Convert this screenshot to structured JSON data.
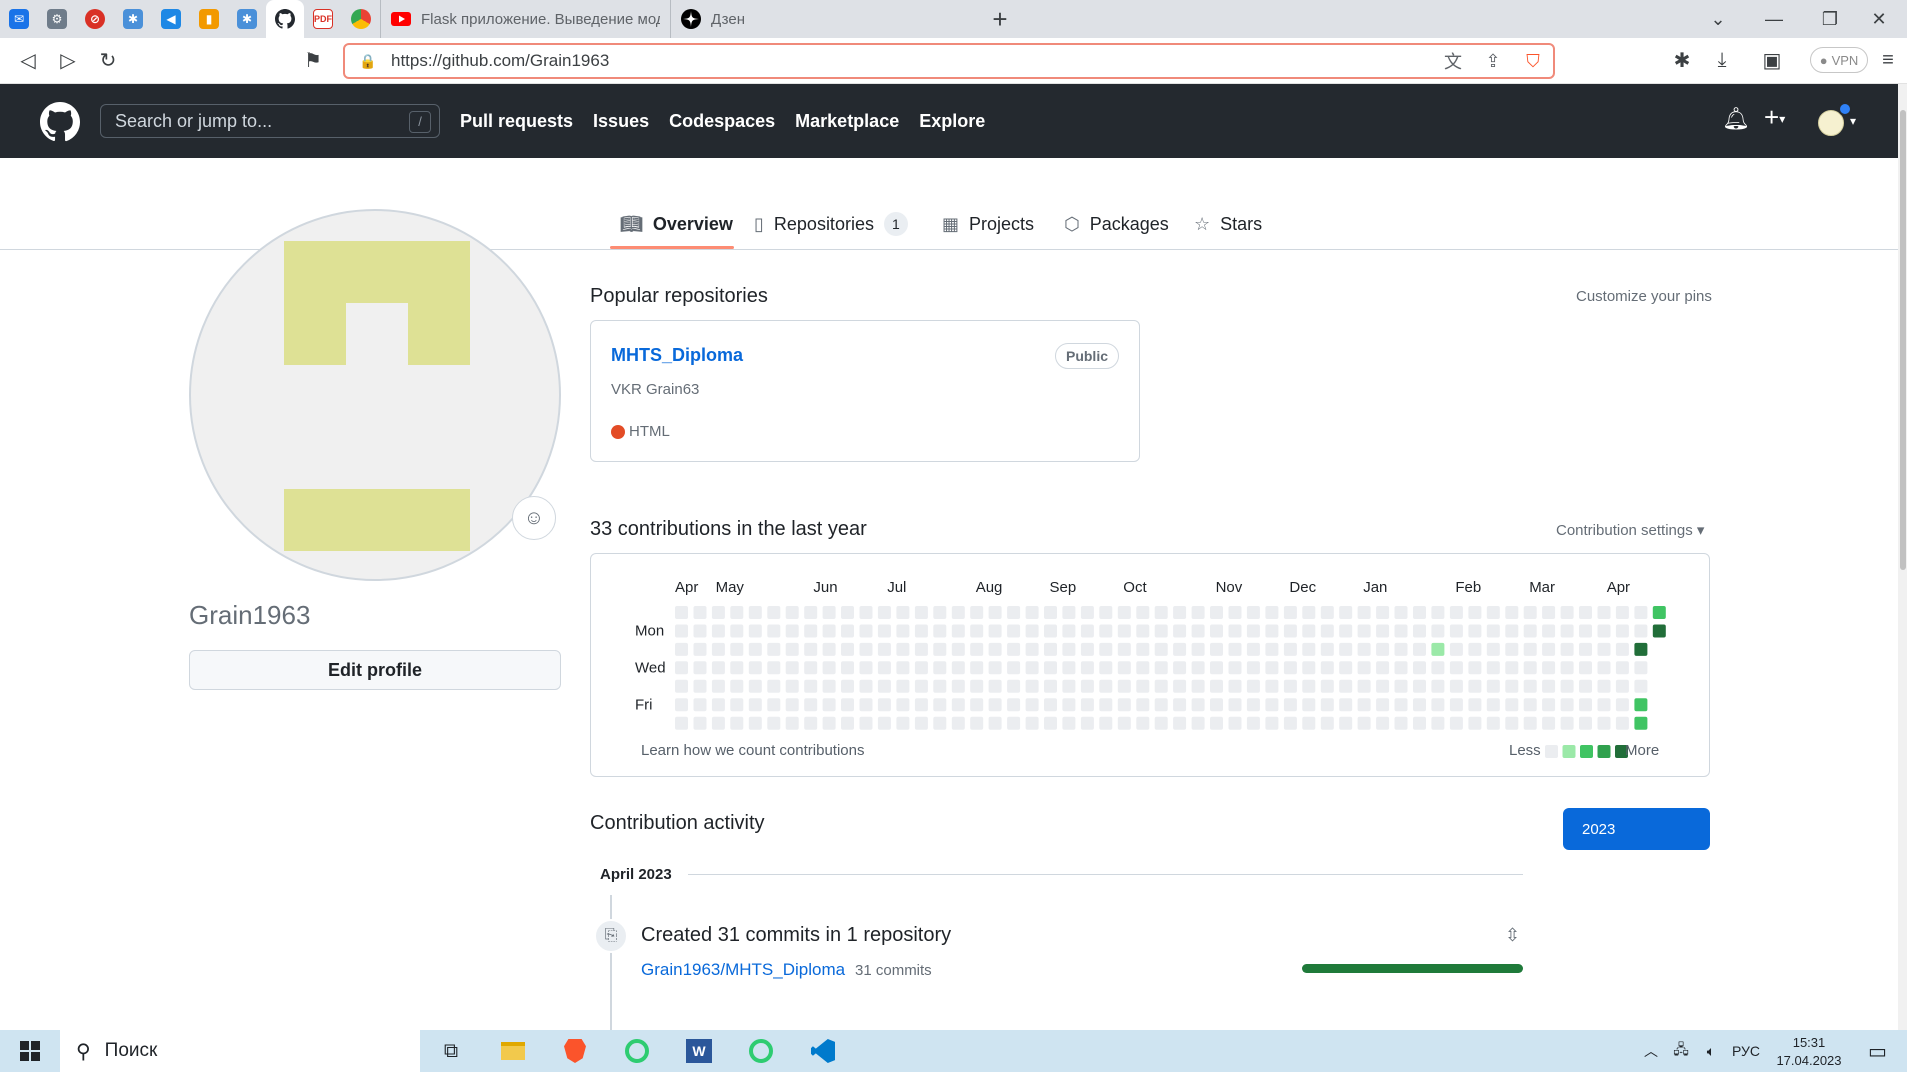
{
  "browser": {
    "pinned_tabs": [
      {
        "icon": "mail-icon",
        "color": "#1a73e8"
      },
      {
        "icon": "extension-icon",
        "color": "#6f7c8a"
      },
      {
        "icon": "adblock-icon",
        "color": "#d93025"
      },
      {
        "icon": "puzzle-app-icon",
        "color": "#4a90d9"
      },
      {
        "icon": "vscode-icon",
        "color": "#1e88e5"
      },
      {
        "icon": "chart-app-icon",
        "color": "#f29900"
      },
      {
        "icon": "puzzle-app-icon",
        "color": "#4a90d9"
      },
      {
        "icon": "github-icon",
        "color": "#24292f"
      },
      {
        "icon": "pdf24-icon",
        "color": "#d93025"
      },
      {
        "icon": "chrome-icon",
        "color": "#34a853"
      }
    ],
    "tabs": [
      {
        "title": "Flask приложение. Выведение моде",
        "icon": "youtube-icon"
      },
      {
        "title": "Дзен",
        "icon": "dzen-icon"
      }
    ],
    "url": "https://github.com/Grain1963",
    "vpn_label": "VPN"
  },
  "github": {
    "search_placeholder": "Search or jump to...",
    "search_shortcut": "/",
    "nav": [
      "Pull requests",
      "Issues",
      "Codespaces",
      "Marketplace",
      "Explore"
    ]
  },
  "profile_tabs": {
    "overview": "Overview",
    "repositories": "Repositories",
    "repositories_count": "1",
    "projects": "Projects",
    "packages": "Packages",
    "stars": "Stars"
  },
  "sidebar": {
    "username": "Grain1963",
    "edit_profile": "Edit profile"
  },
  "popular": {
    "title": "Popular repositories",
    "customize": "Customize your pins",
    "repo": {
      "name": "MHTS_Diploma",
      "visibility": "Public",
      "description": "VKR Grain63",
      "language": "HTML",
      "language_color": "#e34c26"
    }
  },
  "contributions": {
    "title": "33 contributions in the last year",
    "settings": "Contribution settings",
    "months": [
      "Apr",
      "May",
      "Jun",
      "Jul",
      "Aug",
      "Sep",
      "Oct",
      "Nov",
      "Dec",
      "Jan",
      "Feb",
      "Mar",
      "Apr"
    ],
    "day_labels": [
      "Mon",
      "Wed",
      "Fri"
    ],
    "learn": "Learn how we count contributions",
    "less": "Less",
    "more": "More",
    "colors": [
      "#ebedf0",
      "#9be9a8",
      "#40c463",
      "#30a14e",
      "#216e39"
    ],
    "active_days": [
      {
        "week": 41,
        "day": 2,
        "level": 1
      },
      {
        "week": 52,
        "day": 2,
        "level": 4
      },
      {
        "week": 52,
        "day": 5,
        "level": 2
      },
      {
        "week": 52,
        "day": 6,
        "level": 2
      },
      {
        "week": 53,
        "day": 0,
        "level": 2
      },
      {
        "week": 53,
        "day": 1,
        "level": 4
      }
    ]
  },
  "activity": {
    "title": "Contribution activity",
    "year": "2023",
    "month": "April 2023",
    "summary": "Created 31 commits in 1 repository",
    "repo": "Grain1963/MHTS_Diploma",
    "commits": "31 commits"
  },
  "taskbar": {
    "search": "Поиск",
    "lang": "РУС",
    "time": "15:31",
    "date": "17.04.2023"
  }
}
